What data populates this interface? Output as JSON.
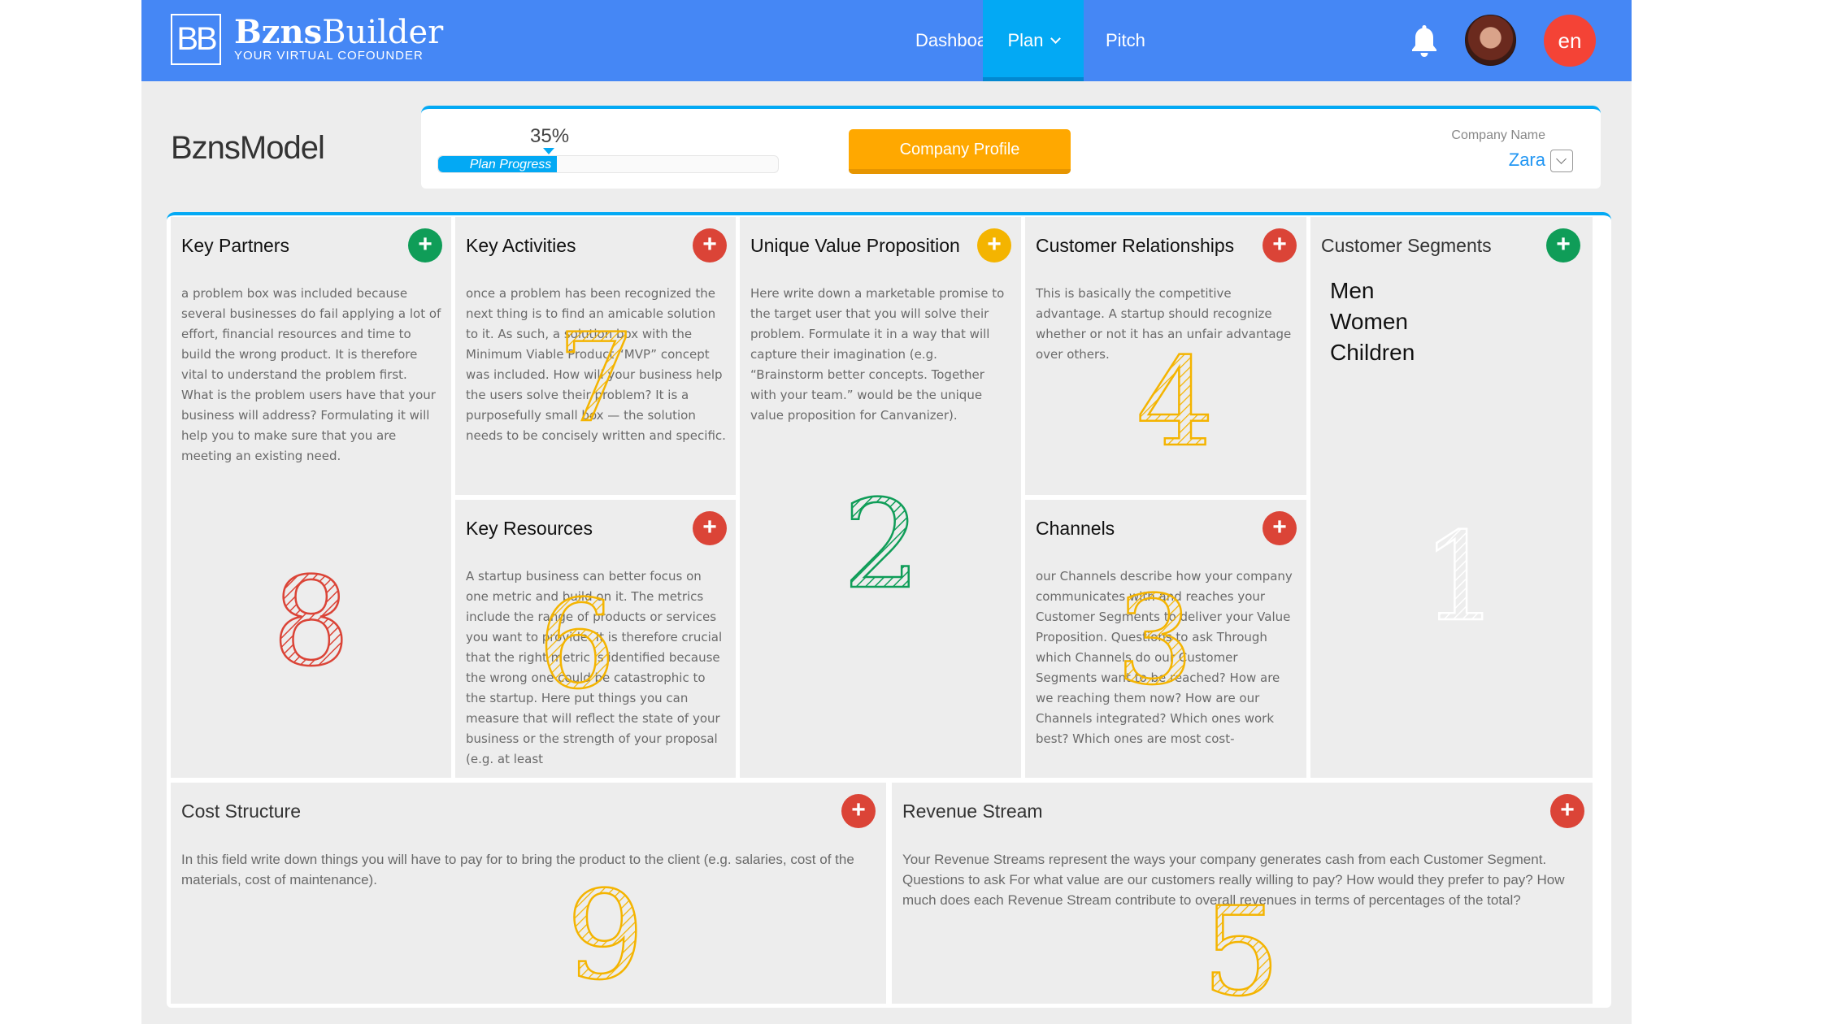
{
  "header": {
    "logo_mark": "BB",
    "logo_bold": "Bzns",
    "logo_light": "Builder",
    "tagline": "YOUR VIRTUAL COFOUNDER",
    "nav": [
      {
        "label": "Dashboard",
        "active": false
      },
      {
        "label": "Plan",
        "active": true
      },
      {
        "label": "Pitch",
        "active": false
      }
    ],
    "language": "en",
    "icons": {
      "notifications": "bell-icon",
      "profile": "user-avatar",
      "dropdown": "chevron-down-icon"
    }
  },
  "page": {
    "title": "BznsModel",
    "progress": {
      "percent_label": "35%",
      "value": 35,
      "label": "Plan Progress"
    },
    "company_profile_button": "Company Profile",
    "company_name_label": "Company Name",
    "company_name_value": "Zara"
  },
  "canvas": {
    "key_partners": {
      "title": "Key Partners",
      "number": "8",
      "color": "#db4437",
      "add_color": "#0f9d58",
      "text": "a problem box was included because several businesses do fail applying a lot of effort, financial resources and time to build the wrong product. It is therefore vital to understand the problem first. What is the problem users have that your business will address? Formulating it will help you to make sure that you are meeting an existing need."
    },
    "key_activities": {
      "title": "Key Activities",
      "number": "7",
      "color": "#f4b400",
      "add_color": "#db4437",
      "text": "once a problem has been recognized the next thing is to find an amicable solution to it. As such, a solution box with the Minimum Viable Product “MVP” concept was included. How will your business help the users solve their problem? It is a purposefully small box — the solution needs to be concisely written and specific."
    },
    "key_resources": {
      "title": "Key Resources",
      "number": "6",
      "color": "#f4b400",
      "add_color": "#db4437",
      "text": "A startup business can better focus on one metric and build on it. The metrics include the range of products or services you want to provide. It is therefore crucial that the right metric is identified because the wrong one could be catastrophic to the startup. Here put things you can measure that will reflect the state of your business or the strength of your proposal (e.g. at least"
    },
    "unique_value_proposition": {
      "title": "Unique Value Proposition",
      "number": "2",
      "color": "#0f9d58",
      "add_color": "#f4b400",
      "text": "Here write down a marketable promise to the target user that you will solve their problem. Formulate it in a way that will capture their imagination (e.g. “Brainstorm better concepts. Together with your team.” would be the unique value proposition for Canvanizer)."
    },
    "customer_relationships": {
      "title": "Customer Relationships",
      "number": "4",
      "color": "#f4b400",
      "add_color": "#db4437",
      "text": "This is basically the competitive advantage. A startup should recognize whether or not it has an unfair advantage over others."
    },
    "channels": {
      "title": "Channels",
      "number": "3",
      "color": "#f4b400",
      "add_color": "#db4437",
      "text": "our Channels describe how your company communicates with and reaches your Customer Segments to deliver your Value Proposition. Questions to ask Through which Channels do our Customer Segments want to be reached? How are we reaching them now? How are our Channels integrated? Which ones work best? Which ones are most cost-"
    },
    "customer_segments": {
      "title": "Customer Segments",
      "number": "1",
      "color": "#ffffff",
      "add_color": "#0f9d58",
      "items": [
        "Men",
        "Women",
        "Children"
      ]
    },
    "cost_structure": {
      "title": "Cost Structure",
      "number": "9",
      "color": "#f4b400",
      "add_color": "#db4437",
      "text": "In this field write down things you will have to pay for to bring the product to the client (e.g. salaries, cost of the materials, cost of maintenance)."
    },
    "revenue_stream": {
      "title": "Revenue Stream",
      "number": "5",
      "color": "#f4b400",
      "add_color": "#db4437",
      "text": "Your Revenue Streams represent the ways your company generates cash from each Customer Segment. Questions to ask For what value are our customers really willing to pay? How would they prefer to pay? How much does each Revenue Stream contribute to overall revenues in terms of percentages of the total?"
    }
  }
}
